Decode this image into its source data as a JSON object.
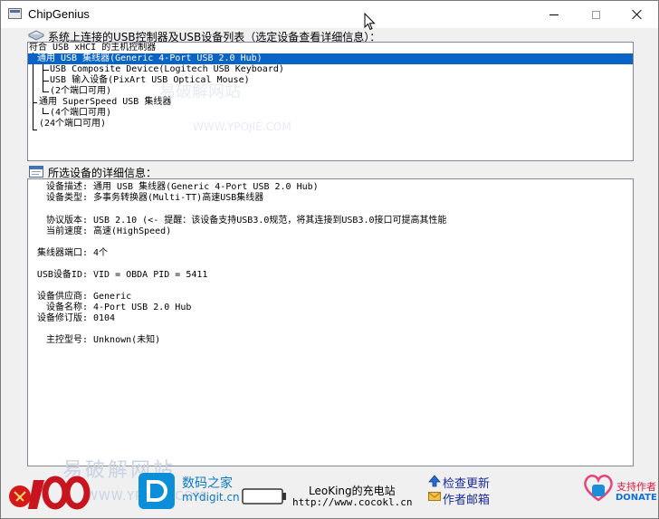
{
  "window": {
    "title": "ChipGenius"
  },
  "icons": {
    "app": "chipgenius-app-icon",
    "tree_section": "usb-tree-icon",
    "details_section": "details-window-icon",
    "cursor": "mouse-cursor-icon"
  },
  "colors": {
    "selection": "#0a64c8",
    "link": "#1a2a9c",
    "site": "#0a79c4",
    "donate": "#d81c3c"
  },
  "device_tree": {
    "label": "系统上连接的USB控制器及USB设备列表（选定设备查看详细信息）：",
    "items": [
      {
        "text": "符合 USB xHCI 的主机控制器",
        "selected": false
      },
      {
        "text": "通用 USB 集线器(Generic 4-Port USB 2.0 Hub)",
        "selected": true
      },
      {
        "text": "USB Composite Device(Logitech USB Keyboard)",
        "selected": false
      },
      {
        "text": "USB 输入设备(PixArt USB Optical Mouse)",
        "selected": false
      },
      {
        "text": "(2个端口可用)",
        "selected": false
      },
      {
        "text": "通用 SuperSpeed USB 集线器",
        "selected": false
      },
      {
        "text": "(4个端口可用)",
        "selected": false
      },
      {
        "text": "(24个端口可用)",
        "selected": false
      }
    ]
  },
  "details": {
    "label": "所选设备的详细信息：",
    "rows": [
      {
        "label": "设备描述:",
        "value": "通用 USB 集线器(Generic 4-Port USB 2.0 Hub)"
      },
      {
        "label": "设备类型:",
        "value": "多事务转换器(Multi-TT)高速USB集线器"
      },
      {
        "label": "协议版本:",
        "value": "USB 2.10 (<- 提醒：该设备支持USB3.0规范，将其连接到USB3.0接口可提高其性能"
      },
      {
        "label": "当前速度:",
        "value": "高速(HighSpeed)"
      },
      {
        "label": "集线器端口:",
        "value": "4个"
      },
      {
        "label": "USB设备ID:",
        "value": "VID = OBDA PID = 5411"
      },
      {
        "label": "设备供应商:",
        "value": "Generic"
      },
      {
        "label": "设备名称:",
        "value": "4-Port USB 2.0 Hub"
      },
      {
        "label": "设备修订版:",
        "value": "0104"
      },
      {
        "label": "主控型号:",
        "value": "Unknown(未知)"
      }
    ]
  },
  "footer": {
    "logo": "100-years-anniversary-logo",
    "site_name": "数码之家",
    "site_url": "mYdigit.cn",
    "battery_icon": "battery-icon",
    "author_name": "LeoKing的充电站",
    "author_url": "http://www.cocokl.cn",
    "update_label": "检查更新",
    "mail_label": "作者邮箱",
    "donate_cn": "支持作者",
    "donate_en": "DONATE"
  },
  "watermark": {
    "cn": "易破解网站",
    "url": "WWW.YPOJIE.COM"
  }
}
